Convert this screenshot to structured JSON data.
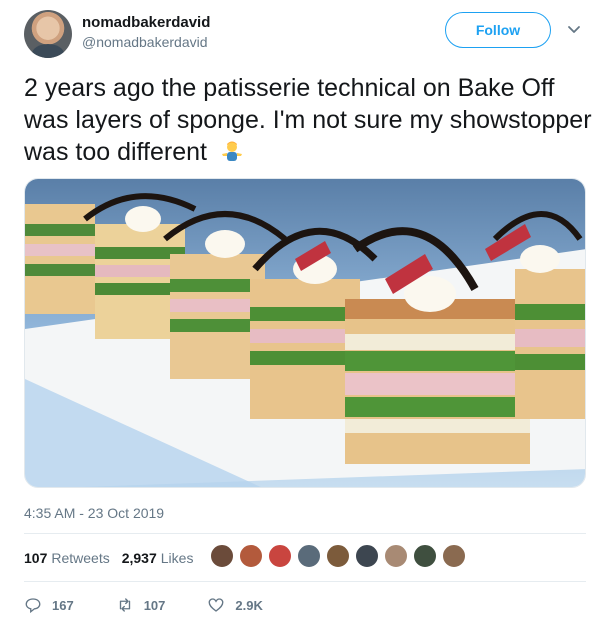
{
  "user": {
    "display_name": "nomadbakerdavid",
    "handle": "@nomadbakerdavid",
    "follow_label": "Follow"
  },
  "tweet": {
    "text": "2 years ago the patisserie technical on Bake Off was layers of sponge. I'm not sure my showstopper was too different",
    "emoji": "man-shrugging-emoji",
    "image_alt": "Layered green and pink sponge cakes with cream and chocolate curls",
    "timestamp": "4:35 AM - 23 Oct 2019"
  },
  "stats": {
    "retweets_count": "107",
    "retweets_label": "Retweets",
    "likes_count": "2,937",
    "likes_label": "Likes"
  },
  "likers": [
    "#6b4b3a",
    "#b35a3c",
    "#c9453f",
    "#5a6b7a",
    "#7c5b3b",
    "#3d4650",
    "#a88a74",
    "#3f4f3f",
    "#8a6a50"
  ],
  "actions": {
    "replies": "167",
    "retweets": "107",
    "likes": "2.9K"
  },
  "colors": {
    "accent": "#1da1f2",
    "secondary_text": "#657786"
  }
}
